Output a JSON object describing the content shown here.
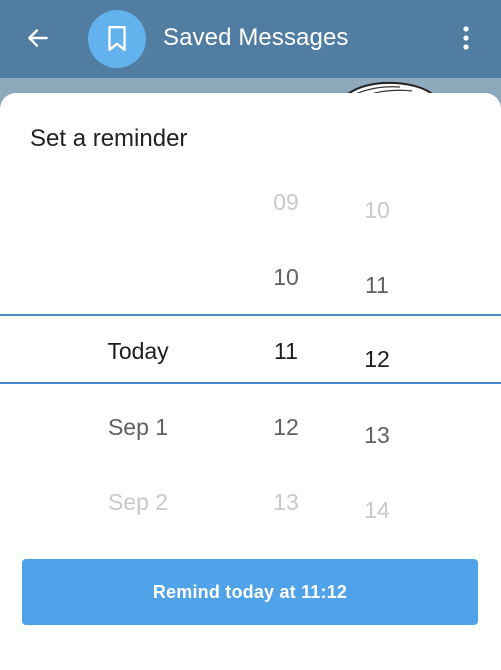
{
  "header": {
    "title": "Saved Messages"
  },
  "sheet": {
    "title": "Set a reminder",
    "days": [
      {
        "label": "Today",
        "state": "selected"
      },
      {
        "label": "Sep 1",
        "state": "mid"
      },
      {
        "label": "Sep 2",
        "state": "faded"
      }
    ],
    "hours": [
      {
        "label": "09",
        "state": "faded"
      },
      {
        "label": "10",
        "state": "mid"
      },
      {
        "label": "11",
        "state": "selected"
      },
      {
        "label": "12",
        "state": "mid"
      },
      {
        "label": "13",
        "state": "faded"
      }
    ],
    "minutes": [
      {
        "label": "10",
        "state": "faded"
      },
      {
        "label": "11",
        "state": "mid"
      },
      {
        "label": "12",
        "state": "selected"
      },
      {
        "label": "13",
        "state": "mid"
      },
      {
        "label": "14",
        "state": "faded"
      }
    ],
    "button_label": "Remind today at 11:12"
  },
  "colors": {
    "header": "#517da2",
    "accent": "#50a2e9",
    "selection_line": "#4a8bc4"
  },
  "icons": {
    "back": "arrow-left-icon",
    "avatar": "bookmark-icon",
    "menu": "more-vertical-icon"
  }
}
